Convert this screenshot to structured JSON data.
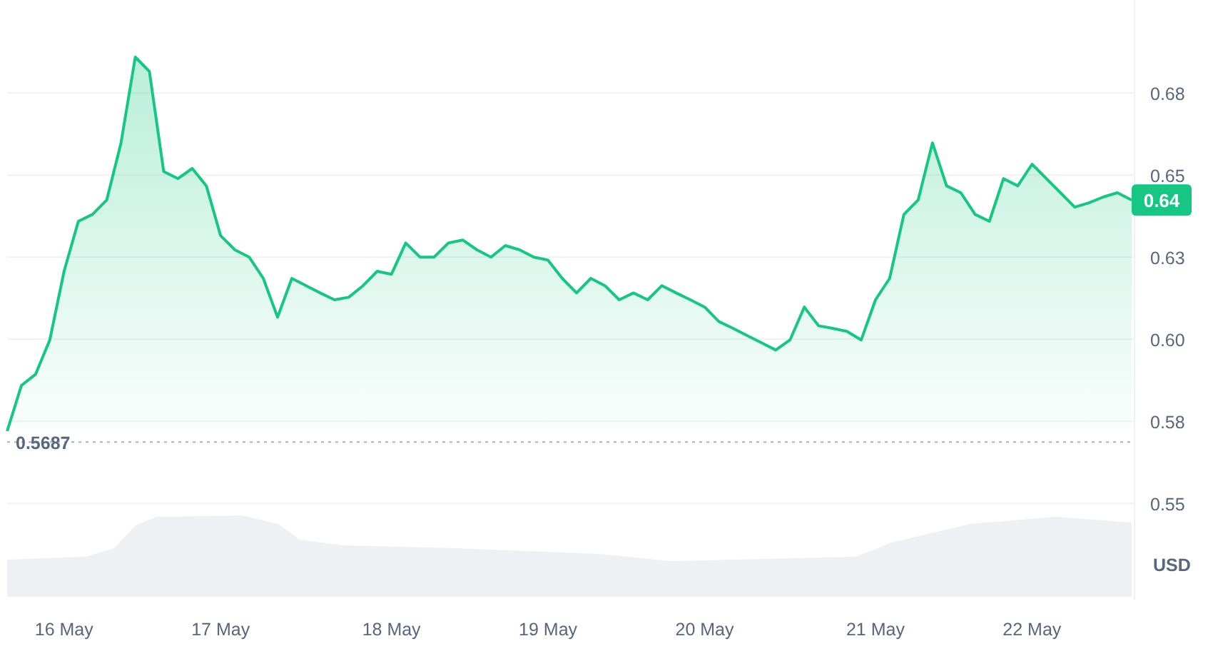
{
  "chart_data": {
    "type": "area",
    "categories": [
      null,
      null,
      null,
      null,
      "16 May",
      null,
      null,
      null,
      null,
      null,
      null,
      null,
      null,
      null,
      null,
      "17 May",
      null,
      null,
      null,
      null,
      null,
      null,
      null,
      null,
      null,
      null,
      null,
      "18 May",
      null,
      null,
      null,
      null,
      null,
      null,
      null,
      null,
      null,
      null,
      "19 May",
      null,
      null,
      null,
      null,
      null,
      null,
      null,
      null,
      null,
      null,
      "20 May",
      null,
      null,
      null,
      null,
      null,
      null,
      null,
      null,
      null,
      null,
      null,
      "21 May",
      null,
      null,
      null,
      null,
      null,
      null,
      null,
      null,
      null,
      null,
      "22 May",
      null,
      null,
      null,
      null,
      null,
      null,
      null
    ],
    "series": [
      {
        "color": "#16c784",
        "values": [
          0.572,
          0.5859,
          0.5893,
          0.5998,
          0.6207,
          0.6359,
          0.638,
          0.6424,
          0.6598,
          0.6859,
          0.6815,
          0.6511,
          0.6489,
          0.652,
          0.6467,
          0.6315,
          0.6272,
          0.625,
          0.6185,
          0.6067,
          0.6185,
          0.6163,
          0.6141,
          0.612,
          0.6128,
          0.6163,
          0.6207,
          0.6198,
          0.6293,
          0.625,
          0.625,
          0.6293,
          0.6302,
          0.6272,
          0.625,
          0.6285,
          0.6272,
          0.625,
          0.6241,
          0.6185,
          0.6141,
          0.6185,
          0.6163,
          0.612,
          0.6141,
          0.612,
          0.6163,
          0.6141,
          0.612,
          0.6098,
          0.6054,
          0.6033,
          0.6011,
          0.5989,
          0.5967,
          0.5998,
          0.6098,
          0.6041,
          0.6033,
          0.6024,
          0.5998,
          0.612,
          0.6185,
          0.638,
          0.6424,
          0.6598,
          0.6467,
          0.6446,
          0.638,
          0.6359,
          0.6489,
          0.6467,
          0.6533,
          0.6489,
          0.6446,
          0.6402,
          0.6415,
          0.6433,
          0.6446,
          0.6424
        ]
      }
    ],
    "ylim": [
      0.5207,
      0.7033
    ],
    "grid": true,
    "ref_lines": [
      {
        "axis": "y",
        "value": 0.5687,
        "label": "0.5687",
        "color": "#a6b0c3"
      }
    ],
    "yticks": [
      {
        "value": 0.675,
        "label": "0.68"
      },
      {
        "value": 0.65,
        "label": "0.65"
      },
      {
        "value": 0.625,
        "label": "0.63"
      },
      {
        "value": 0.6,
        "label": "0.60"
      },
      {
        "value": 0.575,
        "label": "0.58"
      },
      {
        "value": 0.55,
        "label": "0.55"
      }
    ],
    "orientation": "vertical"
  },
  "price_tag": {
    "label": "0.64"
  },
  "currency": "USD"
}
